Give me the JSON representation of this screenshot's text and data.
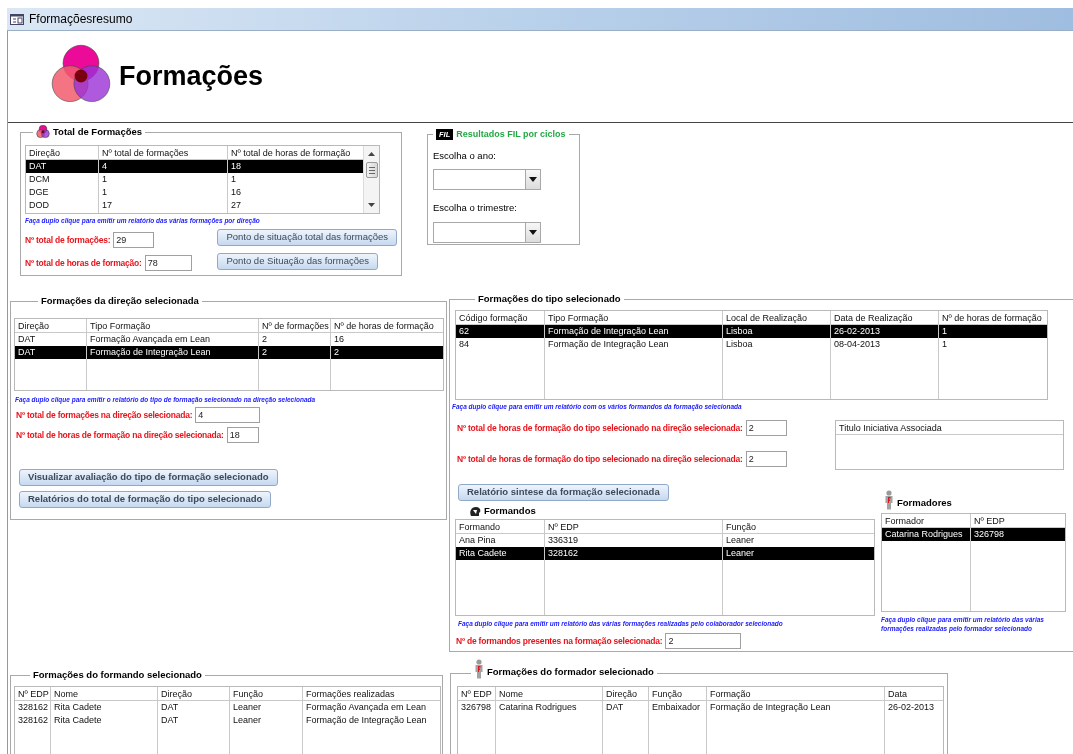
{
  "window": {
    "title": "Fformaçõesresumo"
  },
  "header": {
    "title": "Formações"
  },
  "total": {
    "title": "Total de Formações",
    "table": {
      "columns": [
        "Direção",
        "Nº total de formações",
        "Nº total de horas de formação"
      ],
      "rows": [
        {
          "cells": [
            "DAT",
            "4",
            "18"
          ],
          "selected": true
        },
        {
          "cells": [
            "DCM",
            "1",
            "1"
          ],
          "selected": false
        },
        {
          "cells": [
            "DGE",
            "1",
            "16"
          ],
          "selected": false
        },
        {
          "cells": [
            "DOD",
            "17",
            "27"
          ],
          "selected": false
        }
      ]
    },
    "hint": "Faça duplo clique para emitir um relatório das várias formações por direção",
    "fields": [
      {
        "label": "Nº total de formações:",
        "value": "29"
      },
      {
        "label": "Nº total de horas de formação:",
        "value": "78"
      }
    ],
    "buttons": [
      "Ponto de situação total das formações",
      "Ponto de Situação das formações"
    ]
  },
  "fil": {
    "badge": "FIL",
    "title": "Resultados FIL por ciclos",
    "selects": [
      {
        "label": "Escolha o ano:"
      },
      {
        "label": "Escolha o trimestre:"
      }
    ]
  },
  "direcao": {
    "title": "Formações da direção selecionada",
    "table": {
      "columns": [
        "Direção",
        "Tipo Formação",
        "Nº de formações",
        "Nº de horas de formação"
      ],
      "rows": [
        {
          "cells": [
            "DAT",
            "Formação Avançada em Lean",
            "2",
            "16"
          ],
          "selected": false
        },
        {
          "cells": [
            "DAT",
            "Formação de Integração Lean",
            "2",
            "2"
          ],
          "selected": true
        }
      ]
    },
    "hint": "Faça duplo clique para emitir o relatório do tipo de formação selecionado na direção selecionada",
    "fields": [
      {
        "label": "Nº total de formações na direção selecionada:",
        "value": "4"
      },
      {
        "label": "Nº total de horas de formação na direção selecionada:",
        "value": "18"
      }
    ],
    "buttons": [
      "Visualizar avaliação do tipo de formação selecionado",
      "Relatórios do total de formação do tipo selecionado"
    ]
  },
  "tipo": {
    "title": "Formações do tipo selecionado",
    "table": {
      "columns": [
        "Código formação",
        "Tipo Formação",
        "Local de Realização",
        "Data de Realização",
        "Nº de horas de formação"
      ],
      "rows": [
        {
          "cells": [
            "62",
            "Formação de Integração Lean",
            "Lisboa",
            "26-02-2013",
            "1"
          ],
          "selected": true
        },
        {
          "cells": [
            "84",
            "Formação de Integração Lean",
            "Lisboa",
            "08-04-2013",
            "1"
          ],
          "selected": false
        }
      ]
    },
    "hint": "Faça duplo clique para emitir um relatório com os vários formandos da formação selecionada",
    "fields": [
      {
        "label": "Nº total de horas de formação do tipo selecionado na direção selecionada:",
        "value": "2"
      },
      {
        "label": "Nº total de horas de formação do tipo selecionado na direção selecionada:",
        "value": "2"
      }
    ],
    "iniciativa": {
      "columns": [
        "Titulo Iniciativa Associada"
      ]
    },
    "button": "Relatório sintese da formação selecionada",
    "formandos": {
      "title": "Formandos",
      "table": {
        "columns": [
          "Formando",
          "Nº EDP",
          "Função"
        ],
        "rows": [
          {
            "cells": [
              "Ana Pina",
              "336319",
              "Leaner"
            ],
            "selected": false
          },
          {
            "cells": [
              "Rita Cadete",
              "328162",
              "Leaner"
            ],
            "selected": true
          }
        ]
      },
      "hint": "Faça duplo clique para emitir um relatório das várias formações realizadas pelo colaborador selecionado",
      "field": {
        "label": "Nº de formandos presentes na formação selecionada:",
        "value": "2"
      }
    },
    "formadores": {
      "title": "Formadores",
      "table": {
        "columns": [
          "Formador",
          "Nº EDP"
        ],
        "rows": [
          {
            "cells": [
              "Catarina Rodrigues",
              "326798"
            ],
            "selected": true
          }
        ]
      },
      "hint": "Faça duplo clique para emitir um relatório das várias formações realizadas pelo formador selecionado"
    }
  },
  "formando_sel": {
    "title": "Formações do formando selecionado",
    "table": {
      "columns": [
        "Nº EDP",
        "Nome",
        "Direção",
        "Função",
        "Formações realizadas"
      ],
      "rows": [
        {
          "cells": [
            "328162",
            "Rita Cadete",
            "DAT",
            "Leaner",
            "Formação Avançada em Lean"
          ],
          "selected": false
        },
        {
          "cells": [
            "328162",
            "Rita Cadete",
            "DAT",
            "Leaner",
            "Formação de Integração Lean"
          ],
          "selected": false
        }
      ]
    }
  },
  "formador_sel": {
    "title": "Formações do formador selecionado",
    "table": {
      "columns": [
        "Nº EDP",
        "Nome",
        "Direção",
        "Função",
        "Formação",
        "Data"
      ],
      "rows": [
        {
          "cells": [
            "326798",
            "Catarina Rodrigues",
            "DAT",
            "Embaixador",
            "Formação de Integração Lean",
            "26-02-2013"
          ],
          "selected": false
        }
      ]
    }
  }
}
